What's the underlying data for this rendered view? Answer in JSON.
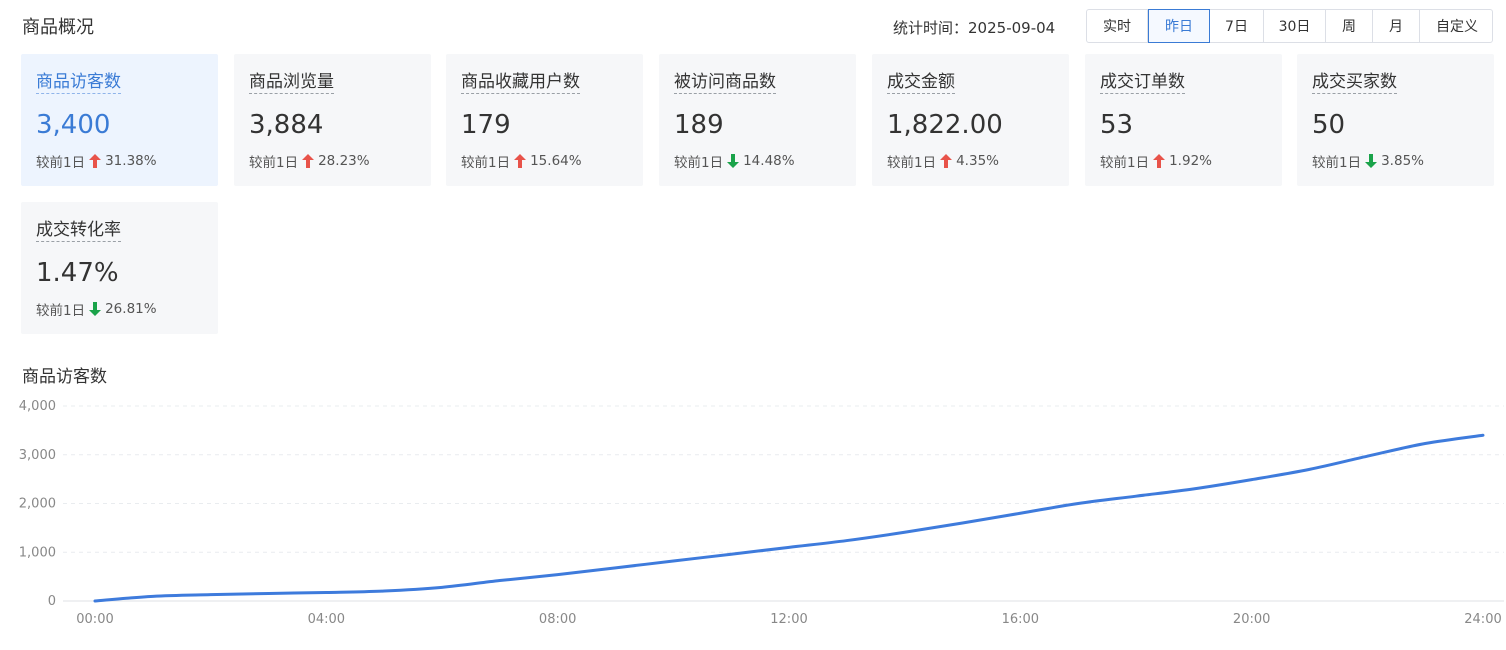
{
  "page": {
    "title": "商品概况",
    "stat_time_label": "统计时间：",
    "stat_time_value": "2025-09-04"
  },
  "range_tabs": [
    {
      "label": "实时",
      "active": false
    },
    {
      "label": "昨日",
      "active": true
    },
    {
      "label": "7日",
      "active": false
    },
    {
      "label": "30日",
      "active": false
    },
    {
      "label": "周",
      "active": false
    },
    {
      "label": "月",
      "active": false
    },
    {
      "label": "自定义",
      "active": false
    }
  ],
  "colors": {
    "accent": "#3a7bd5",
    "up": "#e8534a",
    "down": "#1aa34a",
    "line": "#3e7bdc"
  },
  "cards": [
    {
      "title": "商品访客数",
      "value": "3,400",
      "compare_label": "较前1日",
      "direction": "up",
      "change": "31.38%",
      "selected": true
    },
    {
      "title": "商品浏览量",
      "value": "3,884",
      "compare_label": "较前1日",
      "direction": "up",
      "change": "28.23%",
      "selected": false
    },
    {
      "title": "商品收藏用户数",
      "value": "179",
      "compare_label": "较前1日",
      "direction": "up",
      "change": "15.64%",
      "selected": false
    },
    {
      "title": "被访问商品数",
      "value": "189",
      "compare_label": "较前1日",
      "direction": "down",
      "change": "14.48%",
      "selected": false
    },
    {
      "title": "成交金额",
      "value": "1,822.00",
      "compare_label": "较前1日",
      "direction": "up",
      "change": "4.35%",
      "selected": false
    },
    {
      "title": "成交订单数",
      "value": "53",
      "compare_label": "较前1日",
      "direction": "up",
      "change": "1.92%",
      "selected": false
    },
    {
      "title": "成交买家数",
      "value": "50",
      "compare_label": "较前1日",
      "direction": "down",
      "change": "3.85%",
      "selected": false
    },
    {
      "title": "成交转化率",
      "value": "1.47%",
      "compare_label": "较前1日",
      "direction": "down",
      "change": "26.81%",
      "selected": false
    }
  ],
  "chart_data": {
    "type": "line",
    "title": "商品访客数",
    "x_tick_labels": [
      "00:00",
      "04:00",
      "08:00",
      "12:00",
      "16:00",
      "20:00",
      "24:00"
    ],
    "y_tick_labels": [
      "0",
      "1,000",
      "2,000",
      "3,000",
      "4,000"
    ],
    "ylim": [
      0,
      4000
    ],
    "xlim": [
      0,
      24
    ],
    "grid": true,
    "series": [
      {
        "values_x": [
          0,
          1,
          2,
          3,
          4,
          5,
          6,
          7,
          8,
          9,
          10,
          11,
          12,
          13,
          14,
          15,
          16,
          17,
          18,
          19,
          20,
          21,
          22,
          23,
          24
        ],
        "values_y": [
          0,
          95,
          130,
          155,
          175,
          205,
          280,
          420,
          540,
          680,
          820,
          960,
          1100,
          1240,
          1410,
          1600,
          1800,
          2000,
          2150,
          2300,
          2490,
          2700,
          2970,
          3230,
          3400
        ]
      }
    ]
  }
}
